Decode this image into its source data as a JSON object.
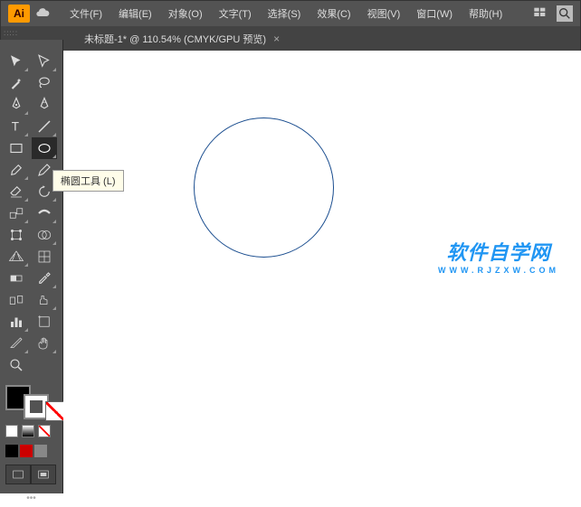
{
  "app": {
    "logo": "Ai"
  },
  "menu": {
    "items": [
      "文件(F)",
      "编辑(E)",
      "对象(O)",
      "文字(T)",
      "选择(S)",
      "效果(C)",
      "视图(V)",
      "窗口(W)",
      "帮助(H)"
    ]
  },
  "tab": {
    "title": "未标题-1* @ 110.54% (CMYK/GPU 预览)",
    "close": "×"
  },
  "tooltip": {
    "text": "椭圆工具 (L)"
  },
  "watermark": {
    "main": "软件自学网",
    "sub": "WWW.RJZXW.COM"
  },
  "colors": {
    "row1": [
      "#000000",
      "#cc0000",
      "#888888"
    ],
    "accent": "#1a4d8f"
  }
}
